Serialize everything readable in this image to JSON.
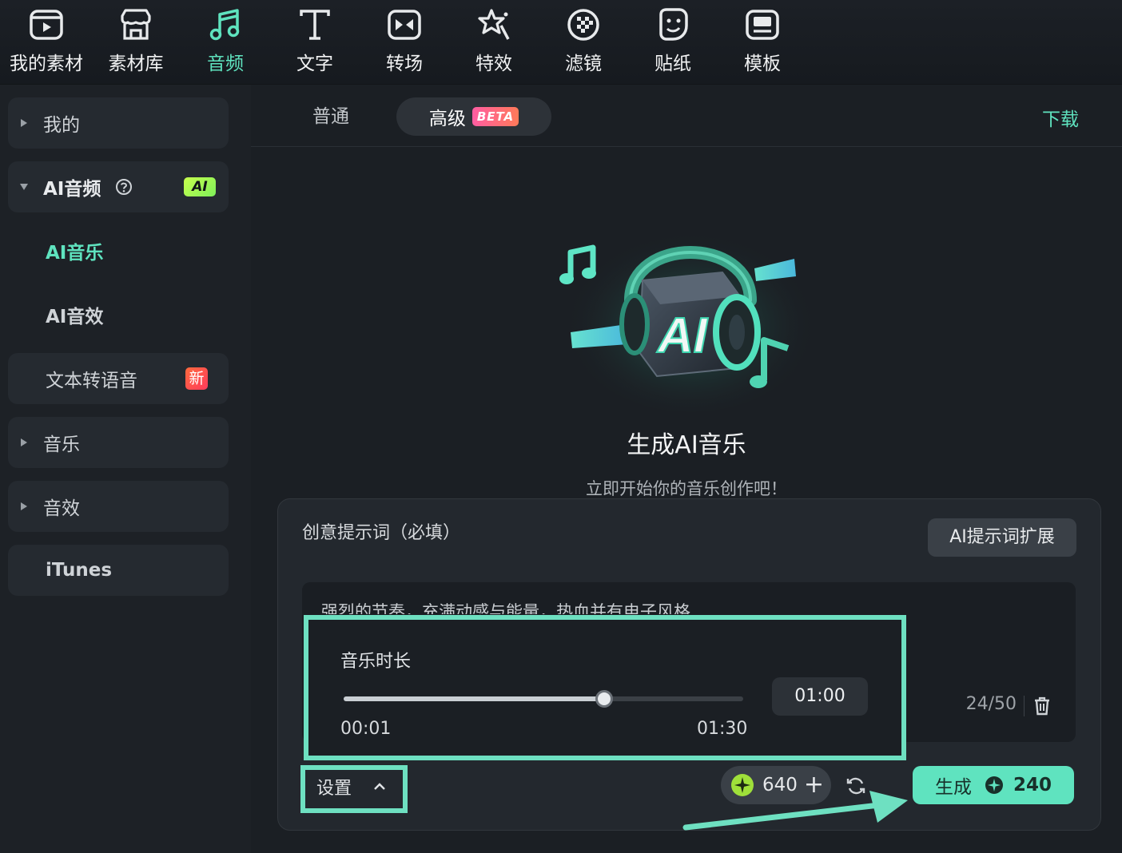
{
  "toolbar": {
    "items": [
      {
        "label": "我的素材",
        "icon": "folder-play-icon"
      },
      {
        "label": "素材库",
        "icon": "store-icon"
      },
      {
        "label": "音频",
        "icon": "music-note-icon",
        "active": true
      },
      {
        "label": "文字",
        "icon": "text-icon"
      },
      {
        "label": "转场",
        "icon": "transition-icon"
      },
      {
        "label": "特效",
        "icon": "effects-star-icon"
      },
      {
        "label": "滤镜",
        "icon": "filter-icon"
      },
      {
        "label": "贴纸",
        "icon": "sticker-icon"
      },
      {
        "label": "模板",
        "icon": "template-icon"
      }
    ]
  },
  "sidebar": {
    "items": [
      {
        "label": "我的"
      },
      {
        "label": "AI音频",
        "badge": "AI"
      },
      {
        "label": "AI音乐"
      },
      {
        "label": "AI音效"
      },
      {
        "label": "文本转语音",
        "badge": "新"
      },
      {
        "label": "音乐"
      },
      {
        "label": "音效"
      },
      {
        "label": "iTunes"
      }
    ]
  },
  "main": {
    "tabs": {
      "normal": "普通",
      "advanced": "高级",
      "beta": "BETA"
    },
    "download": "下载",
    "title": "生成AI音乐",
    "subtitle": "立即开始你的音乐创作吧！",
    "hero_text": "AI",
    "card": {
      "label": "创意提示词（必填）",
      "expand_button": "AI提示词扩展",
      "prompt": "强烈的节奏，充满动感与能量，热血并有电子风格",
      "counter": "24/50",
      "settings": "设置",
      "credits": "640",
      "generate": "生成",
      "cost": "240"
    }
  },
  "duration": {
    "label": "音乐时长",
    "min": "00:01",
    "max": "01:30",
    "value": "01:00",
    "fraction": 0.6517
  },
  "colors": {
    "accent": "#5fe3bf",
    "highlight": "#6ee0c1"
  }
}
